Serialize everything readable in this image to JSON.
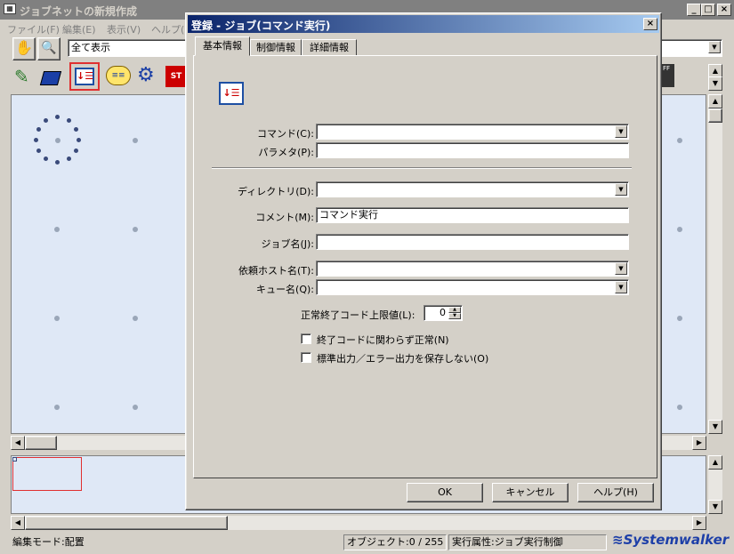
{
  "main_window": {
    "title": "ジョブネットの新規作成",
    "menu": [
      "ファイル(F)",
      "編集(E)",
      "表示(V)",
      "ヘルプ(H"
    ],
    "view_combo_value": "全て表示"
  },
  "dialog": {
    "title": "登録 - ジョブ(コマンド実行)",
    "tabs": [
      "基本情報",
      "制御情報",
      "詳細情報"
    ],
    "fields": {
      "command_label": "コマンド(C):",
      "command_value": "",
      "parameter_label": "パラメタ(P):",
      "parameter_value": "",
      "directory_label": "ディレクトリ(D):",
      "directory_value": "",
      "comment_label": "コメント(M):",
      "comment_value": "コマンド実行",
      "job_name_label": "ジョブ名(J):",
      "job_name_value": "",
      "host_label": "依頼ホスト名(T):",
      "host_value": "",
      "queue_label": "キュー名(Q):",
      "queue_value": "",
      "exit_code_label": "正常終了コード上限値(L):",
      "exit_code_value": "0"
    },
    "checkboxes": [
      {
        "label": "終了コードに関わらず正常(N)",
        "checked": false
      },
      {
        "label": "標準出力／エラー出力を保存しない(O)",
        "checked": false
      }
    ],
    "buttons": {
      "ok": "OK",
      "cancel": "キャンセル",
      "help": "ヘルプ(H)"
    }
  },
  "status_bar": {
    "mode": "編集モード:配置",
    "objects": "オブジェクト:0 / 255",
    "exec_attr": "実行属性:ジョブ実行制御",
    "brand": "Systemwalker"
  },
  "colors": {
    "active_title": "#0a246a",
    "canvas_bg": "#dfe8f6",
    "selection_red": "#e03030"
  }
}
